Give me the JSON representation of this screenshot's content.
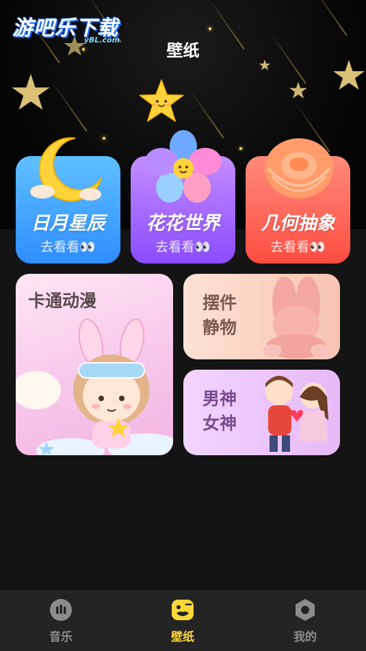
{
  "watermark": {
    "text": "游吧乐下载",
    "sub": "yBL.com"
  },
  "header": {
    "title": "壁纸"
  },
  "categories": [
    {
      "name": "日月星辰",
      "action": "去看看👀",
      "color": "#3d9bff"
    },
    {
      "name": "花花世界",
      "action": "去看看👀",
      "color": "#a56bff"
    },
    {
      "name": "几何抽象",
      "action": "去看看👀",
      "color": "#ff5f52"
    }
  ],
  "tiles": {
    "cartoon": "卡通动漫",
    "still": "摆件静物",
    "couple": "男神女神"
  },
  "tabbar": {
    "items": [
      {
        "label": "音乐",
        "icon": "music-bubble-icon",
        "active": false
      },
      {
        "label": "壁纸",
        "icon": "wallpaper-face-icon",
        "active": true
      },
      {
        "label": "我的",
        "icon": "profile-hexagon-icon",
        "active": false
      }
    ],
    "active_color": "#ffd83a",
    "inactive_color": "#8c8c8c"
  }
}
